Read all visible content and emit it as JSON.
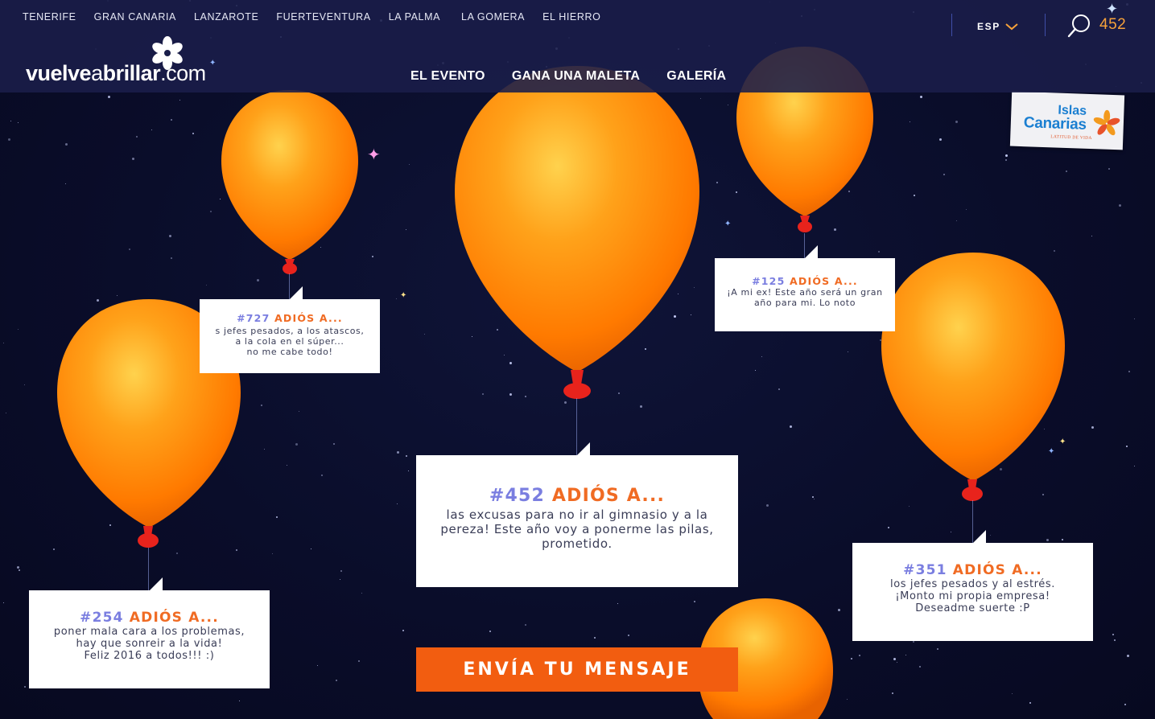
{
  "top_nav": {
    "islands": [
      "TENERIFE",
      "GRAN CANARIA",
      "LANZAROTE",
      "FUERTEVENTURA",
      "LA PALMA",
      "LA GOMERA",
      "EL HIERRO"
    ]
  },
  "logo": {
    "part1": "vuelve",
    "part2": "a",
    "part3": "brillar",
    "part4": ".com"
  },
  "main_nav": {
    "items": [
      "EL EVENTO",
      "GANA UNA MALETA",
      "GALERÍA"
    ]
  },
  "language": {
    "label": "ESP"
  },
  "counter": {
    "value": "452"
  },
  "brand": {
    "line1": "Islas",
    "line2": "Canarias",
    "tagline": "LATITUD DE VIDA"
  },
  "messages": [
    {
      "id": "#727",
      "title": "ADIÓS A...",
      "lines": [
        "s jefes pesados, a los atascos,",
        "a la cola en el súper...",
        "no me cabe todo!"
      ]
    },
    {
      "id": "#125",
      "title": "ADIÓS A...",
      "lines": [
        "¡A mi ex! Este año será un gran",
        "año para mi. Lo noto"
      ]
    },
    {
      "id": "#452",
      "title": "ADIÓS A...",
      "lines": [
        "las excusas para no ir al gimnasio y a la",
        "pereza! Este año voy a ponerme las pilas,",
        "prometido."
      ]
    },
    {
      "id": "#254",
      "title": "ADIÓS A...",
      "lines": [
        "poner mala cara a los problemas,",
        "hay que sonreir a la vida!",
        "Feliz 2016 a todos!!! :)"
      ]
    },
    {
      "id": "#351",
      "title": "ADIÓS A...",
      "lines": [
        "los jefes pesados y al estrés.",
        "¡Monto mi propia empresa!",
        "Deseadme suerte :P"
      ]
    }
  ],
  "cta": {
    "label": "ENVÍA TU MENSAJE"
  },
  "colors": {
    "balloon": "#ff8a00",
    "accent": "#f25d10",
    "number": "#7a7ee0",
    "header": "#1a1e4a",
    "background": "#0a0d2a"
  }
}
